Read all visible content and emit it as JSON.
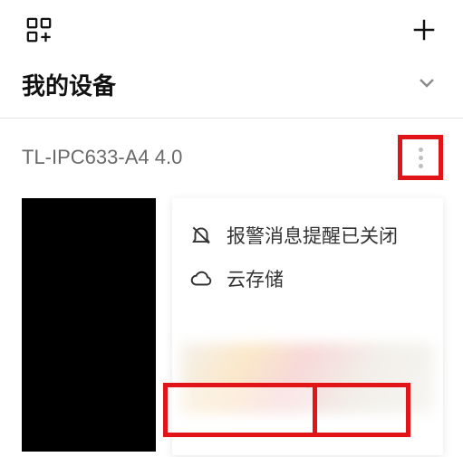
{
  "topbar": {
    "grid_icon": "grid-add",
    "plus_icon": "plus"
  },
  "section": {
    "title": "我的设备",
    "chevron": "chevron-down"
  },
  "device": {
    "name": "TL-IPC633-A4 4.0",
    "more": "more-vertical",
    "menu": {
      "items": [
        {
          "icon": "bell-off",
          "label": "报警消息提醒已关闭"
        },
        {
          "icon": "cloud",
          "label": "云存储"
        }
      ]
    }
  },
  "colors": {
    "highlight": "#e11417",
    "muted_text": "#6a6a6a"
  }
}
